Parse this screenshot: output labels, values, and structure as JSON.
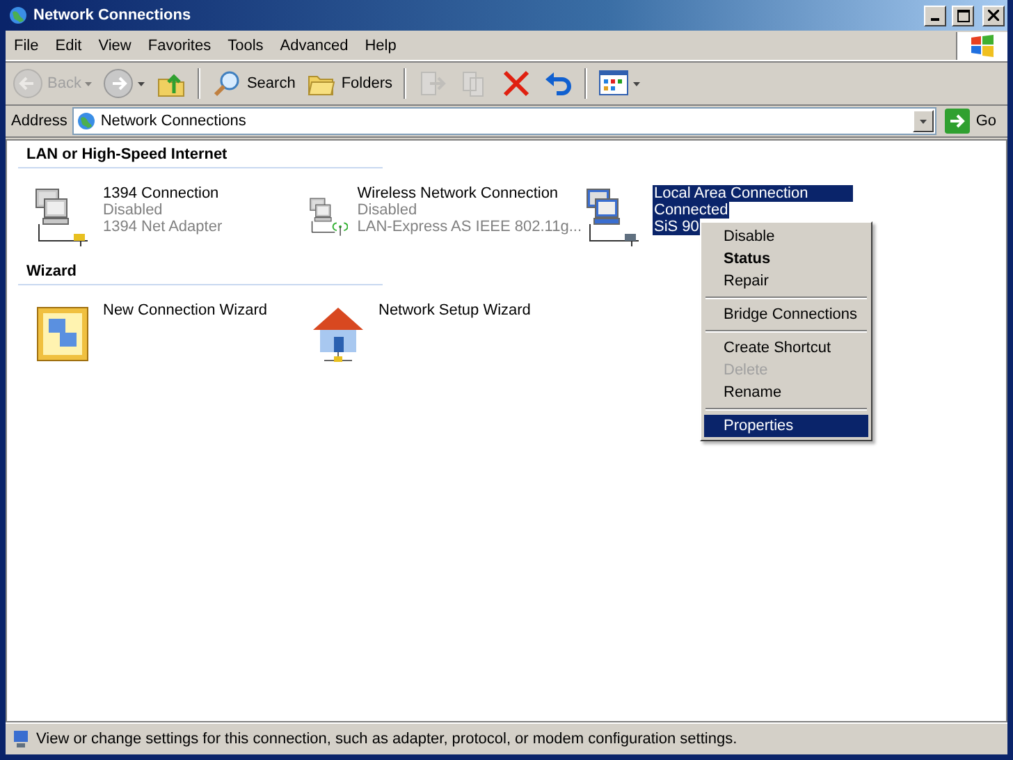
{
  "window": {
    "title": "Network Connections"
  },
  "menu_bar": [
    "File",
    "Edit",
    "View",
    "Favorites",
    "Tools",
    "Advanced",
    "Help"
  ],
  "toolbar": [
    {
      "kind": "back",
      "label": "Back",
      "disabled": true
    },
    {
      "kind": "forward",
      "disabled": false
    },
    {
      "kind": "up",
      "disabled": false
    },
    {
      "kind": "search",
      "label": "Search",
      "disabled": false
    },
    {
      "kind": "folders",
      "label": "Folders",
      "disabled": false
    },
    {
      "kind": "move",
      "disabled": true
    },
    {
      "kind": "copy",
      "disabled": true
    },
    {
      "kind": "delete",
      "disabled": false
    },
    {
      "kind": "undo",
      "disabled": false
    },
    {
      "kind": "views",
      "disabled": false
    }
  ],
  "address": {
    "label": "Address",
    "value": "Network Connections",
    "go": "Go"
  },
  "sections": [
    {
      "title": "LAN or High-Speed Internet",
      "items": [
        {
          "kind": "wired",
          "name": "1394 Connection",
          "status": "Disabled",
          "detail": "1394 Net Adapter",
          "disabled": true,
          "selected": false
        },
        {
          "kind": "wireless",
          "name": "Wireless Network Connection",
          "status": "Disabled",
          "detail": "LAN-Express AS IEEE 802.11g...",
          "disabled": true,
          "selected": false
        },
        {
          "kind": "lan",
          "name": "Local Area Connection",
          "status": "Connected",
          "detail": "SiS 90",
          "disabled": false,
          "selected": true
        }
      ]
    },
    {
      "title": "Wizard",
      "items": [
        {
          "kind": "wizard",
          "name": "New Connection Wizard",
          "selected": false
        },
        {
          "kind": "house",
          "name": "Network Setup Wizard",
          "selected": false
        }
      ]
    }
  ],
  "context_menu": [
    {
      "kind": "item",
      "label": "Disable",
      "bold": false,
      "disabled": false,
      "selected": false
    },
    {
      "kind": "item",
      "label": "Status",
      "bold": true,
      "disabled": false,
      "selected": false
    },
    {
      "kind": "item",
      "label": "Repair",
      "bold": false,
      "disabled": false,
      "selected": false
    },
    {
      "kind": "separator"
    },
    {
      "kind": "item",
      "label": "Bridge Connections",
      "bold": false,
      "disabled": false,
      "selected": false
    },
    {
      "kind": "separator"
    },
    {
      "kind": "item",
      "label": "Create Shortcut",
      "bold": false,
      "disabled": false,
      "selected": false
    },
    {
      "kind": "item",
      "label": "Delete",
      "bold": false,
      "disabled": true,
      "selected": false
    },
    {
      "kind": "item",
      "label": "Rename",
      "bold": false,
      "disabled": false,
      "selected": false
    },
    {
      "kind": "separator"
    },
    {
      "kind": "item",
      "label": "Properties",
      "bold": false,
      "disabled": false,
      "selected": true
    }
  ],
  "status_bar": "View or change settings for this connection, such as adapter, protocol, or modem configuration settings."
}
